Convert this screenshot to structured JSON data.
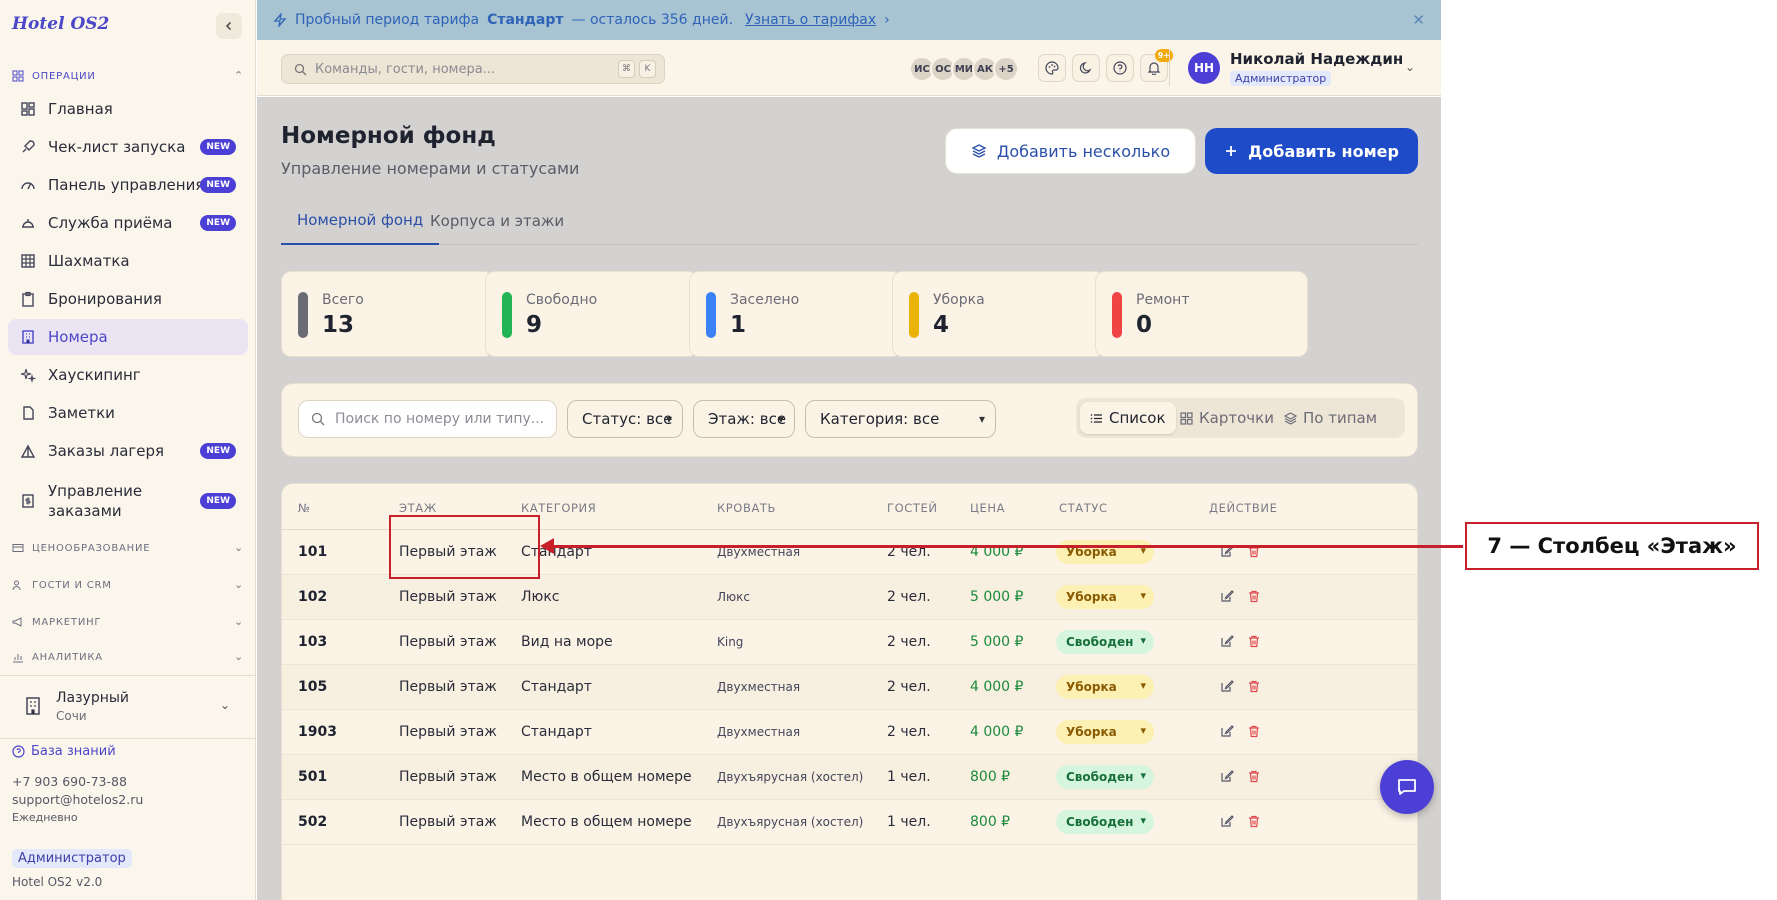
{
  "app": {
    "title": "Hotel OS2",
    "version": "Hotel OS2 v2.0"
  },
  "sidebar": {
    "section_operations": "ОПЕРАЦИИ",
    "items": [
      {
        "label": "Главная",
        "new": false
      },
      {
        "label": "Чек-лист запуска",
        "new": true
      },
      {
        "label": "Панель управления",
        "new": true
      },
      {
        "label": "Служба приёма",
        "new": true
      },
      {
        "label": "Шахматка",
        "new": false
      },
      {
        "label": "Бронирования",
        "new": false
      },
      {
        "label": "Номера",
        "new": false
      },
      {
        "label": "Хаускипинг",
        "new": false
      },
      {
        "label": "Заметки",
        "new": false
      },
      {
        "label": "Заказы лагеря",
        "new": true
      },
      {
        "label": "Управление заказами",
        "new": true
      }
    ],
    "new_badge": "NEW",
    "sections": [
      "ЦЕНООБРАЗОВАНИЕ",
      "ГОСТИ И CRM",
      "МАРКЕТИНГ",
      "АНАЛИТИКА"
    ],
    "hotel": {
      "name": "Лазурный",
      "city": "Сочи"
    },
    "knowledge_base": "База знаний",
    "phone": "+7 903 690-73-88",
    "email": "support@hotelos2.ru",
    "hours": "Ежедневно",
    "role": "Администратор"
  },
  "banner": {
    "prefix": "Пробный период тарифа",
    "plan": "Стандарт",
    "suffix": "— осталось 356 дней.",
    "link": "Узнать о тарифах"
  },
  "header": {
    "command_placeholder": "Команды, гости, номера...",
    "key1": "⌘",
    "key2": "K",
    "avatars": [
      "ИС",
      "ОС",
      "МИ",
      "АК",
      "+5"
    ],
    "notifications": "9+",
    "user_initials": "НН",
    "user_name": "Николай Надеждин",
    "user_role": "Администратор"
  },
  "page": {
    "title": "Номерной фонд",
    "subtitle": "Управление номерами и статусами",
    "add_many": "Добавить несколько",
    "add_one": "Добавить номер",
    "tabs": [
      "Номерной фонд",
      "Корпуса и этажи"
    ]
  },
  "stats": [
    {
      "label": "Всего",
      "value": "13",
      "color": "#6b6b76"
    },
    {
      "label": "Свободно",
      "value": "9",
      "color": "#22b455"
    },
    {
      "label": "Заселено",
      "value": "1",
      "color": "#3b82f6"
    },
    {
      "label": "Уборка",
      "value": "4",
      "color": "#eab308"
    },
    {
      "label": "Ремонт",
      "value": "0",
      "color": "#ef4444"
    }
  ],
  "filters": {
    "search_placeholder": "Поиск по номеру или типу...",
    "status": "Статус: все",
    "floor": "Этаж: все",
    "category": "Категория: все",
    "views": [
      "Список",
      "Карточки",
      "По типам"
    ]
  },
  "table": {
    "columns": [
      "№",
      "ЭТАЖ",
      "КАТЕГОРИЯ",
      "КРОВАТЬ",
      "ГОСТЕЙ",
      "ЦЕНА",
      "СТАТУС",
      "ДЕЙСТВИЕ"
    ],
    "rows": [
      {
        "num": "101",
        "floor": "Первый этаж",
        "category": "Стандарт",
        "bed": "Двухместная",
        "guests": "2 чел.",
        "price": "4 000 ₽",
        "status": "Уборка"
      },
      {
        "num": "102",
        "floor": "Первый этаж",
        "category": "Люкс",
        "bed": "Люкс",
        "guests": "2 чел.",
        "price": "5 000 ₽",
        "status": "Уборка"
      },
      {
        "num": "103",
        "floor": "Первый этаж",
        "category": "Вид на море",
        "bed": "King",
        "guests": "2 чел.",
        "price": "5 000 ₽",
        "status": "Свободен"
      },
      {
        "num": "105",
        "floor": "Первый этаж",
        "category": "Стандарт",
        "bed": "Двухместная",
        "guests": "2 чел.",
        "price": "4 000 ₽",
        "status": "Уборка"
      },
      {
        "num": "1903",
        "floor": "Первый этаж",
        "category": "Стандарт",
        "bed": "Двухместная",
        "guests": "2 чел.",
        "price": "4 000 ₽",
        "status": "Уборка"
      },
      {
        "num": "501",
        "floor": "Первый этаж",
        "category": "Место в общем номере",
        "bed": "Двухъярусная (хостел)",
        "guests": "1 чел.",
        "price": "800 ₽",
        "status": "Свободен"
      },
      {
        "num": "502",
        "floor": "Первый этаж",
        "category": "Место в общем номере",
        "bed": "Двухъярусная (хостел)",
        "guests": "1 чел.",
        "price": "800 ₽",
        "status": "Свободен"
      }
    ]
  },
  "annotation": {
    "label": "7 — Столбец «Этаж»"
  }
}
